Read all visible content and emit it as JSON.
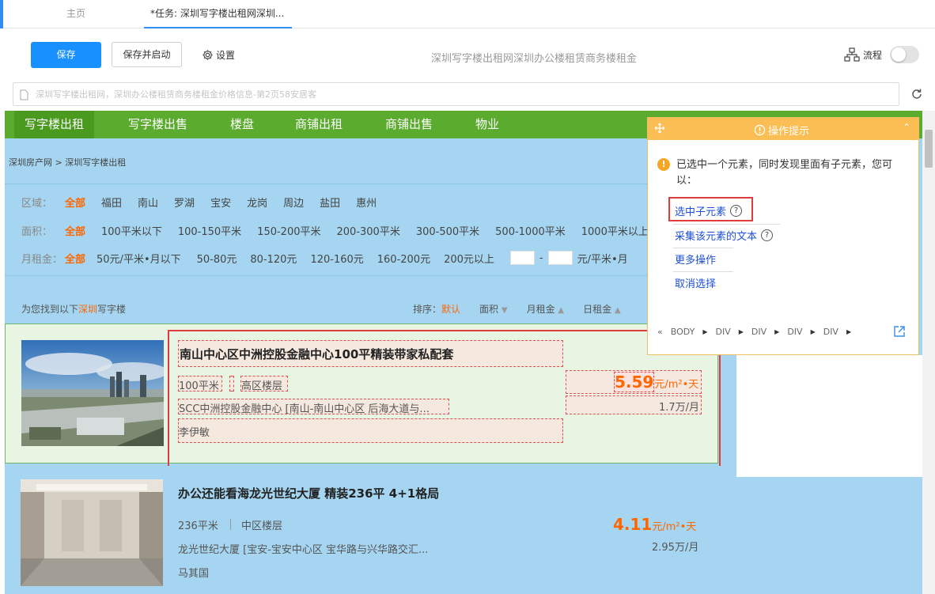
{
  "tabs": {
    "home": "主页",
    "task": "*任务: 深圳写字楼出租网深圳..."
  },
  "toolbar": {
    "save": "保存",
    "save_start": "保存并启动",
    "settings": "设置",
    "page_title": "深圳写字楼出租网深圳办公楼租赁商务楼租金",
    "flow": "流程",
    "flow_toggle_on": false
  },
  "urlbar": {
    "value": "深圳写字楼出租网，深圳办公楼租赁商务楼租金价格信息-第2页58安居客"
  },
  "site": {
    "nav": [
      "写字楼出租",
      "写字楼出售",
      "楼盘",
      "商铺出租",
      "商铺出售",
      "物业"
    ],
    "breadcrumb": "深圳房产网 > 深圳写字楼出租",
    "filters": {
      "district": {
        "label": "区域：",
        "options": [
          "全部",
          "福田",
          "南山",
          "罗湖",
          "宝安",
          "龙岗",
          "周边",
          "盐田",
          "惠州"
        ]
      },
      "area": {
        "label": "面积：",
        "options": [
          "全部",
          "100平米以下",
          "100-150平米",
          "150-200平米",
          "200-300平米",
          "300-500平米",
          "500-1000平米",
          "1000平米以上"
        ]
      },
      "rent": {
        "label": "月租金：",
        "options": [
          "全部",
          "50元/平米•月以下",
          "50-80元",
          "80-120元",
          "120-160元",
          "160-200元",
          "200元以上"
        ],
        "range_sep": "-",
        "unit": "元/平米•月"
      }
    },
    "result_prefix": "为您找到以下",
    "result_city": "深圳",
    "result_suffix": "写字楼",
    "sort": {
      "label": "排序：",
      "options": [
        "默认",
        "面积",
        "月租金",
        "日租金"
      ]
    },
    "listings": [
      {
        "title": "南山中心区中洲控股金融中心100平精装带家私配套",
        "area": "100平米",
        "floor": "高区楼层",
        "address": "SCC中洲控股金融中心 [南山-南山中心区 后海大道与...",
        "agent": "李伊敏",
        "price": "5.59",
        "price_unit": "元/m²•天",
        "total": "1.7万/月"
      },
      {
        "title": "办公还能看海龙光世纪大厦 精装236平 4+1格局",
        "area": "236平米",
        "floor": "中区楼层",
        "address": "龙光世纪大厦 [宝安-宝安中心区 宝华路与兴华路交汇...",
        "agent": "马其国",
        "price": "4.11",
        "price_unit": "元/m²•天",
        "total": "2.95万/月"
      }
    ]
  },
  "hint": {
    "title": "操作提示",
    "message": "已选中一个元素，同时发现里面有子元素，您可以：",
    "actions": [
      "选中子元素",
      "采集该元素的文本",
      "更多操作",
      "取消选择"
    ],
    "path": [
      "BODY",
      "DIV",
      "DIV",
      "DIV",
      "DIV"
    ],
    "path_back": "«"
  },
  "colors": {
    "accent": "#1890ff",
    "nav_green": "#5aab2e",
    "page_bg": "#a5d5f0",
    "price": "#ff6600",
    "selection": "#e03c3c",
    "hint_header": "#fbbe55"
  }
}
